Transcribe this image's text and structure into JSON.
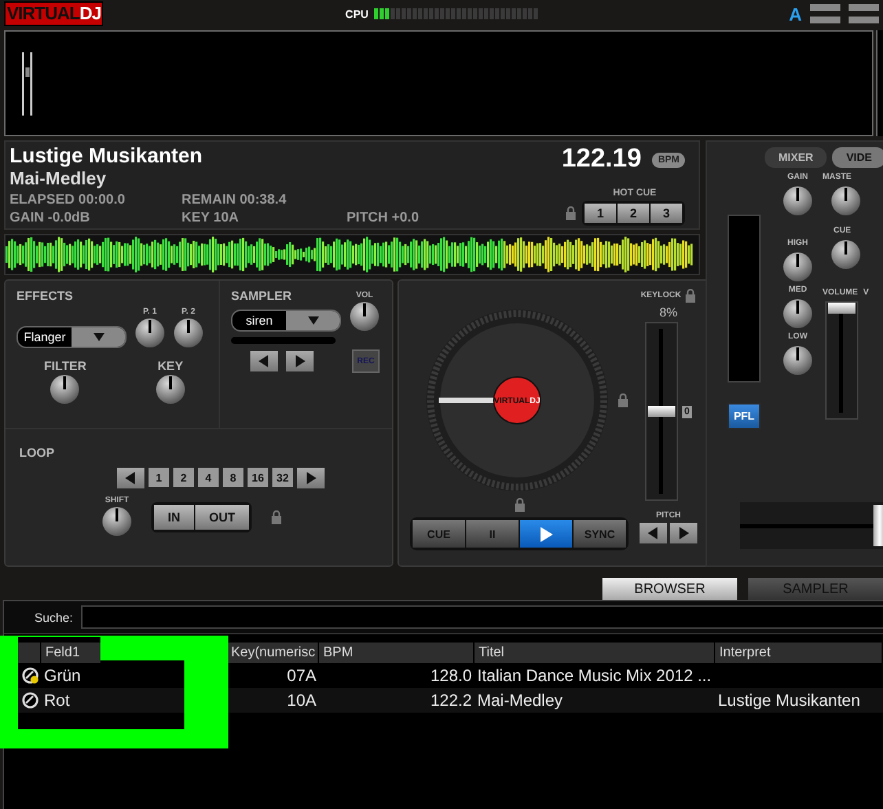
{
  "topbar": {
    "logo_left": "VIRTUAL",
    "logo_right": "DJ",
    "cpu_label": "CPU",
    "cpu": {
      "level": 0.1
    },
    "skin_letter": "A"
  },
  "deck": {
    "artist": "Lustige Musikanten",
    "title": "Mai-Medley",
    "bpm": "122.19",
    "bpm_badge": "BPM",
    "elapsed": "ELAPSED 00:00.0",
    "remain": "REMAIN 00:38.4",
    "gain": "GAIN -0.0dB",
    "key": "KEY 10A",
    "pitch": "PITCH +0.0",
    "hot_cue_label": "HOT CUE",
    "hot_cues": [
      "1",
      "2",
      "3"
    ]
  },
  "effects": {
    "title": "EFFECTS",
    "selected_effect": "Flanger",
    "knobs": [
      {
        "label": "P. 1"
      },
      {
        "label": "P. 2"
      }
    ],
    "lower_knobs": [
      {
        "label": "FILTER"
      },
      {
        "label": "KEY"
      }
    ]
  },
  "sampler": {
    "title": "SAMPLER",
    "selected_sample": "siren",
    "vol": {
      "label": "VOL"
    },
    "rec": "REC"
  },
  "loop": {
    "title": "LOOP",
    "sizes": [
      "1",
      "2",
      "4",
      "8",
      "16",
      "32"
    ],
    "shift": {
      "label": "SHIFT"
    },
    "in": "IN",
    "out": "OUT"
  },
  "turntable": {
    "label_left": "VIRTUAL",
    "label_right": "DJ",
    "keylock": "KEYLOCK",
    "range": "8%",
    "zero": "0",
    "pitch_label": "PITCH",
    "pitch": {
      "level": 0.5
    },
    "transport": [
      {
        "kind": "text",
        "label": "CUE",
        "selected": false
      },
      {
        "kind": "text",
        "label": "II",
        "selected": false
      },
      {
        "kind": "play",
        "selected": true
      },
      {
        "kind": "text",
        "label": "SYNC",
        "selected": false
      }
    ]
  },
  "mixer": {
    "tabs": [
      {
        "label": "MIXER",
        "selected": false
      },
      {
        "label": "VIDE",
        "selected": true
      }
    ],
    "eq": [
      {
        "label": "GAIN"
      },
      {
        "label": "HIGH"
      },
      {
        "label": "MED"
      },
      {
        "label": "LOW"
      }
    ],
    "master": [
      {
        "label": "MASTE"
      },
      {
        "label": "CUE"
      }
    ],
    "volume_label": "VOLUME",
    "volume_label_2": "V",
    "volume": {
      "level": 1.0
    },
    "pfl": "PFL",
    "crossfader": {
      "level": 1.0
    }
  },
  "browser": {
    "tabs": [
      {
        "label": "BROWSER",
        "selected": true
      },
      {
        "label": "SAMPLER",
        "selected": false
      }
    ],
    "search_label": "Suche:",
    "columns": [
      "Feld1",
      "Key(numerisc",
      "BPM",
      "Titel",
      "Interpret"
    ],
    "rows": [
      {
        "badge": true,
        "cells": [
          "Grün",
          "07A",
          "128.0",
          "Italian Dance Music Mix 2012 ...",
          ""
        ]
      },
      {
        "badge": false,
        "cells": [
          "Rot",
          "10A",
          "122.2",
          "Mai-Medley",
          "Lustige Musikanten"
        ]
      }
    ]
  }
}
